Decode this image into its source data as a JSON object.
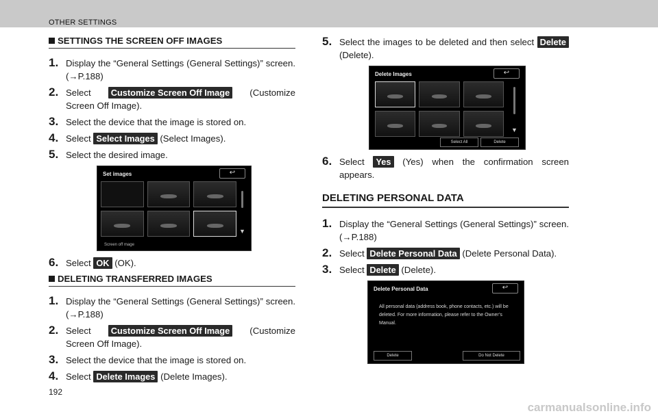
{
  "header": {
    "title": "OTHER SETTINGS"
  },
  "left": {
    "section1": "SETTINGS THE SCREEN OFF IMAGES",
    "s1": {
      "num": "1.",
      "text": "Display the “General Settings (General Settings)” screen. (→P.188)"
    },
    "s2": {
      "num": "2.",
      "pre": "Select ",
      "btn": "Customize Screen Off Image",
      "post": " (Customize Screen Off Image)."
    },
    "s3": {
      "num": "3.",
      "text": "Select the device that the image is stored on."
    },
    "s4": {
      "num": "4.",
      "pre": "Select ",
      "btn": "Select Images",
      "post": " (Select Images)."
    },
    "s5": {
      "num": "5.",
      "text": "Select the desired image."
    },
    "shot1": {
      "title": "Set images",
      "footer": "Screen off mage"
    },
    "s6": {
      "num": "6.",
      "pre": "Select ",
      "btn": "OK",
      "post": " (OK)."
    },
    "section2": "DELETING TRANSFERRED IMAGES",
    "t1": {
      "num": "1.",
      "text": "Display the “General Settings (General Settings)” screen. (→P.188)"
    },
    "t2": {
      "num": "2.",
      "pre": "Select ",
      "btn": "Customize Screen Off Image",
      "post": " (Customize Screen Off Image)."
    },
    "t3": {
      "num": "3.",
      "text": "Select the device that the image is stored on."
    },
    "t4": {
      "num": "4.",
      "pre": "Select ",
      "btn": "Delete Images",
      "post": " (Delete Images)."
    }
  },
  "right": {
    "r5": {
      "num": "5.",
      "pre": "Select the images to be deleted and then select ",
      "btn": "Delete",
      "post": " (Delete)."
    },
    "shot2": {
      "title": "Delete Images",
      "select_all": "Select All",
      "delete": "Delete"
    },
    "r6": {
      "num": "6.",
      "pre": "Select ",
      "btn": "Yes",
      "post": " (Yes) when the confirmation screen appears."
    },
    "section3": "DELETING PERSONAL DATA",
    "p1": {
      "num": "1.",
      "text": "Display the “General Settings (General Settings)” screen. (→P.188)"
    },
    "p2": {
      "num": "2.",
      "pre": "Select ",
      "btn": "Delete Personal Data",
      "post": " (Delete Personal Data)."
    },
    "p3": {
      "num": "3.",
      "pre": "Select ",
      "btn": "Delete",
      "post": " (Delete)."
    },
    "shot3": {
      "title": "Delete Personal Data",
      "message": "All personal data (address book, phone contacts, etc.) will be deleted. For more information, please refer to the Owner’s Manual.",
      "delete": "Delete",
      "do_not_delete": "Do Not Delete"
    }
  },
  "footer": {
    "page": "192",
    "watermark": "carmanualsonline.info"
  }
}
